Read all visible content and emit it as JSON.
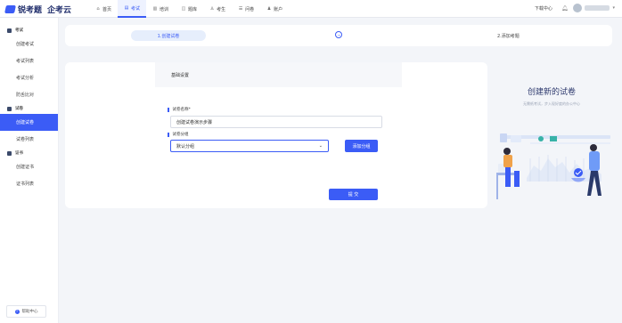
{
  "header": {
    "brand_primary": "锐考题",
    "brand_secondary": "企考云",
    "nav": [
      {
        "label": "首页",
        "icon": "home-icon",
        "glyph": "⌂"
      },
      {
        "label": "考试",
        "icon": "exam-icon",
        "glyph": "▤",
        "active": true
      },
      {
        "label": "培训",
        "icon": "training-icon",
        "glyph": "▥"
      },
      {
        "label": "题库",
        "icon": "question-bank-icon",
        "glyph": "◫"
      },
      {
        "label": "考生",
        "icon": "examinee-icon",
        "glyph": "♙"
      },
      {
        "label": "问卷",
        "icon": "survey-icon",
        "glyph": "☰"
      },
      {
        "label": "账户",
        "icon": "account-icon",
        "glyph": "♟"
      }
    ],
    "help_center": "下载中心",
    "accent_color": "#3b5cf6"
  },
  "sidebar": {
    "groups": [
      {
        "title": "考试",
        "items": [
          "创建考试",
          "考试列表",
          "考试分析",
          "防舌比对"
        ]
      },
      {
        "title": "试卷",
        "items": [
          "创建试卷",
          "试卷列表"
        ]
      },
      {
        "title": "证书",
        "items": [
          "创建证书",
          "证书列表"
        ]
      }
    ],
    "active_item": "创建试卷",
    "help_button": "帮助中心"
  },
  "steps": {
    "step1": "1.创建试卷",
    "step2": "2.添加考题"
  },
  "form": {
    "section_tab": "基础设置",
    "name_label": "试卷名称*",
    "name_value": "创建试卷演示步骤",
    "category_label": "试卷分组",
    "category_value": "默认分组",
    "add_category_button": "添加分组",
    "submit_button": "提 交"
  },
  "right_panel": {
    "title": "创建新的试卷",
    "subtitle": "无需纸考试，步入现好度的办公中心"
  }
}
